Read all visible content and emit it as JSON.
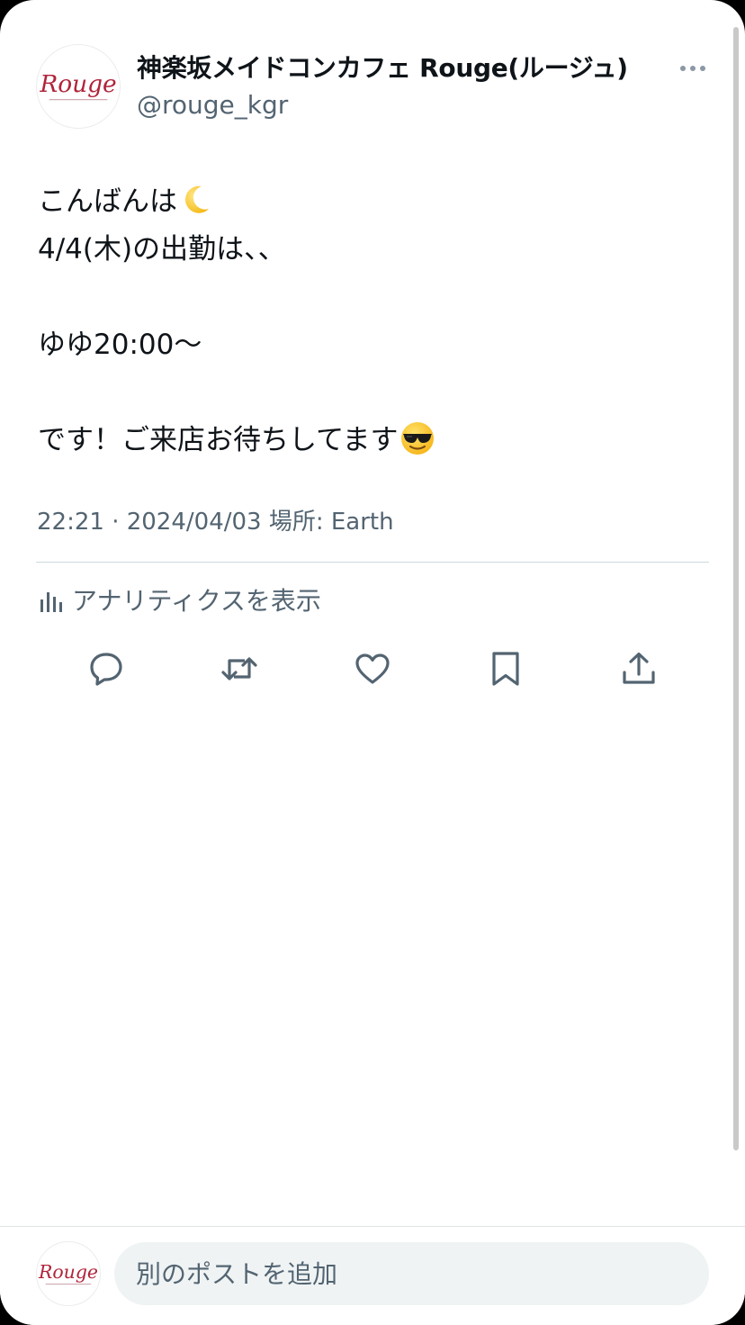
{
  "post": {
    "author": {
      "display_name": "神楽坂メイドコンカフェ Rouge(ルージュ)",
      "handle": "@rouge_kgr",
      "avatar_logo_text": "Rouge"
    },
    "text_lines": [
      "こんばんは",
      "4/4(木)の出勤は、、",
      "",
      "ゆゆ20:00〜",
      "",
      "です！ご来店お待ちしてます"
    ],
    "emojis": {
      "line_1": "crescent-moon",
      "line_6": "smiling-face-with-sunglasses"
    },
    "meta": "22:21 · 2024/04/03 場所: Earth",
    "analytics_label": "アナリティクスを表示",
    "actions": [
      "reply",
      "repost",
      "like",
      "bookmark",
      "share"
    ]
  },
  "composer": {
    "placeholder": "別のポストを追加"
  },
  "colors": {
    "text_primary": "#0f1419",
    "text_secondary": "#536471",
    "divider": "#cfd9de",
    "input_bg": "#eff3f4",
    "logo_red": "#b0243a"
  }
}
